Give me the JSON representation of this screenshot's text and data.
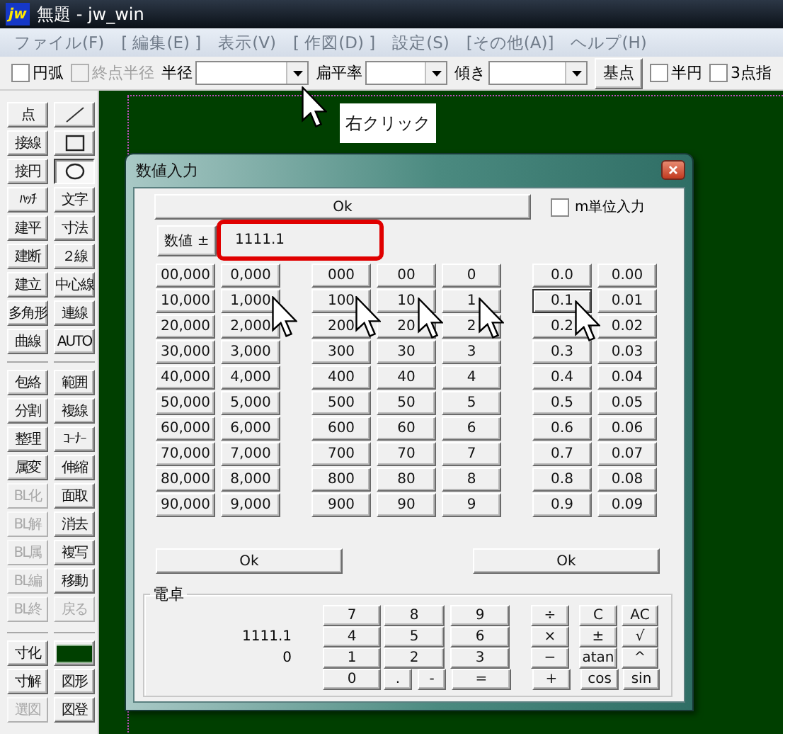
{
  "window": {
    "logo": "jw",
    "title": "無題 - jw_win"
  },
  "menu": [
    "ファイル(F)",
    "[ 編集(E) ]",
    "表示(V)",
    "[ 作図(D) ]",
    "設定(S)",
    "[その他(A)]",
    "ヘルプ(H)"
  ],
  "toolbar": [
    {
      "kind": "checkbox",
      "label": "円弧",
      "checked": false,
      "disabled": false
    },
    {
      "kind": "checkbox",
      "label": "終点半径",
      "checked": false,
      "disabled": true
    },
    {
      "kind": "combo",
      "label": "半径"
    },
    {
      "kind": "combo",
      "label": "扁平率"
    },
    {
      "kind": "combo",
      "label": "傾き"
    },
    {
      "kind": "button",
      "label": "基点"
    },
    {
      "kind": "checkbox",
      "label": "半円",
      "checked": false,
      "disabled": false
    },
    {
      "kind": "checkbox",
      "label": "3点指",
      "checked": false,
      "disabled": false
    }
  ],
  "callout": "右クリック",
  "tool_panel": {
    "columns": [
      {
        "groups": [
          [
            {
              "kind": "text",
              "label": "点",
              "selected": false,
              "disabled": false
            },
            {
              "kind": "text",
              "label": "接線",
              "selected": false,
              "disabled": false
            },
            {
              "kind": "text",
              "label": "接円",
              "selected": false,
              "disabled": false
            },
            {
              "kind": "text",
              "label": "ﾊｯﾁ",
              "selected": false,
              "disabled": false
            },
            {
              "kind": "text",
              "label": "建平",
              "selected": false,
              "disabled": false
            },
            {
              "kind": "text",
              "label": "建断",
              "selected": false,
              "disabled": false
            },
            {
              "kind": "text",
              "label": "建立",
              "selected": false,
              "disabled": false
            },
            {
              "kind": "text",
              "label": "多角形",
              "selected": false,
              "disabled": false
            },
            {
              "kind": "text",
              "label": "曲線",
              "selected": false,
              "disabled": false
            }
          ],
          [
            {
              "kind": "text",
              "label": "包絡",
              "selected": false,
              "disabled": false
            },
            {
              "kind": "text",
              "label": "分割",
              "selected": false,
              "disabled": false
            },
            {
              "kind": "text",
              "label": "整理",
              "selected": false,
              "disabled": false
            },
            {
              "kind": "text",
              "label": "属変",
              "selected": false,
              "disabled": false
            },
            {
              "kind": "text",
              "label": "BL化",
              "selected": false,
              "disabled": true
            },
            {
              "kind": "text",
              "label": "BL解",
              "selected": false,
              "disabled": true
            },
            {
              "kind": "text",
              "label": "BL属",
              "selected": false,
              "disabled": true
            },
            {
              "kind": "text",
              "label": "BL編",
              "selected": false,
              "disabled": true
            },
            {
              "kind": "text",
              "label": "BL終",
              "selected": false,
              "disabled": true
            }
          ],
          [
            {
              "kind": "text",
              "label": "寸化",
              "selected": false,
              "disabled": false
            },
            {
              "kind": "text",
              "label": "寸解",
              "selected": false,
              "disabled": false
            },
            {
              "kind": "text",
              "label": "選図",
              "selected": false,
              "disabled": true
            }
          ]
        ]
      },
      {
        "groups": [
          [
            {
              "kind": "line",
              "selected": false,
              "disabled": false
            },
            {
              "kind": "rect",
              "selected": false,
              "disabled": false
            },
            {
              "kind": "circle",
              "selected": true,
              "disabled": false
            },
            {
              "kind": "text",
              "label": "文字",
              "selected": false,
              "disabled": false
            },
            {
              "kind": "text",
              "label": "寸法",
              "selected": false,
              "disabled": false
            },
            {
              "kind": "text",
              "label": "２線",
              "selected": false,
              "disabled": false
            },
            {
              "kind": "text",
              "label": "中心線",
              "selected": false,
              "disabled": false
            },
            {
              "kind": "text",
              "label": "連線",
              "selected": false,
              "disabled": false
            },
            {
              "kind": "text",
              "label": "AUTO",
              "selected": false,
              "disabled": false
            }
          ],
          [
            {
              "kind": "text",
              "label": "範囲",
              "selected": false,
              "disabled": false
            },
            {
              "kind": "text",
              "label": "複線",
              "selected": false,
              "disabled": false
            },
            {
              "kind": "text",
              "label": "ｺｰﾅｰ",
              "selected": false,
              "disabled": false
            },
            {
              "kind": "text",
              "label": "伸縮",
              "selected": false,
              "disabled": false
            },
            {
              "kind": "text",
              "label": "面取",
              "selected": false,
              "disabled": false
            },
            {
              "kind": "text",
              "label": "消去",
              "selected": false,
              "disabled": false
            },
            {
              "kind": "text",
              "label": "複写",
              "selected": false,
              "disabled": false
            },
            {
              "kind": "text",
              "label": "移動",
              "selected": false,
              "disabled": false
            },
            {
              "kind": "text",
              "label": "戻る",
              "selected": false,
              "disabled": true
            }
          ],
          [
            {
              "kind": "swatch",
              "color": "#004000",
              "selected": false,
              "disabled": false
            },
            {
              "kind": "text",
              "label": "図形",
              "selected": false,
              "disabled": false
            },
            {
              "kind": "text",
              "label": "図登",
              "selected": false,
              "disabled": false
            }
          ]
        ]
      }
    ]
  },
  "dialog": {
    "title": "数値入力",
    "ok_top": "Ok",
    "metric_input": {
      "label": "m単位入力",
      "checked": false
    },
    "value_label": "数値 ±",
    "value": "1111.1",
    "keypad": [
      [
        {
          "label": "00,000",
          "focused": false
        },
        {
          "label": "0,000",
          "focused": false
        },
        {
          "label": "000",
          "focused": false
        },
        {
          "label": "00",
          "focused": false
        },
        {
          "label": "0",
          "focused": false
        },
        {
          "label": "0.0",
          "focused": false
        },
        {
          "label": "0.00",
          "focused": false
        }
      ],
      [
        {
          "label": "10,000",
          "focused": false
        },
        {
          "label": "1,000",
          "focused": false
        },
        {
          "label": "100",
          "focused": false
        },
        {
          "label": "10",
          "focused": false
        },
        {
          "label": "1",
          "focused": false
        },
        {
          "label": "0.1",
          "focused": true
        },
        {
          "label": "0.01",
          "focused": false
        }
      ],
      [
        {
          "label": "20,000",
          "focused": false
        },
        {
          "label": "2,000",
          "focused": false
        },
        {
          "label": "200",
          "focused": false
        },
        {
          "label": "20",
          "focused": false
        },
        {
          "label": "2",
          "focused": false
        },
        {
          "label": "0.2",
          "focused": false
        },
        {
          "label": "0.02",
          "focused": false
        }
      ],
      [
        {
          "label": "30,000",
          "focused": false
        },
        {
          "label": "3,000",
          "focused": false
        },
        {
          "label": "300",
          "focused": false
        },
        {
          "label": "30",
          "focused": false
        },
        {
          "label": "3",
          "focused": false
        },
        {
          "label": "0.3",
          "focused": false
        },
        {
          "label": "0.03",
          "focused": false
        }
      ],
      [
        {
          "label": "40,000",
          "focused": false
        },
        {
          "label": "4,000",
          "focused": false
        },
        {
          "label": "400",
          "focused": false
        },
        {
          "label": "40",
          "focused": false
        },
        {
          "label": "4",
          "focused": false
        },
        {
          "label": "0.4",
          "focused": false
        },
        {
          "label": "0.04",
          "focused": false
        }
      ],
      [
        {
          "label": "50,000",
          "focused": false
        },
        {
          "label": "5,000",
          "focused": false
        },
        {
          "label": "500",
          "focused": false
        },
        {
          "label": "50",
          "focused": false
        },
        {
          "label": "5",
          "focused": false
        },
        {
          "label": "0.5",
          "focused": false
        },
        {
          "label": "0.05",
          "focused": false
        }
      ],
      [
        {
          "label": "60,000",
          "focused": false
        },
        {
          "label": "6,000",
          "focused": false
        },
        {
          "label": "600",
          "focused": false
        },
        {
          "label": "60",
          "focused": false
        },
        {
          "label": "6",
          "focused": false
        },
        {
          "label": "0.6",
          "focused": false
        },
        {
          "label": "0.06",
          "focused": false
        }
      ],
      [
        {
          "label": "70,000",
          "focused": false
        },
        {
          "label": "7,000",
          "focused": false
        },
        {
          "label": "700",
          "focused": false
        },
        {
          "label": "70",
          "focused": false
        },
        {
          "label": "7",
          "focused": false
        },
        {
          "label": "0.7",
          "focused": false
        },
        {
          "label": "0.07",
          "focused": false
        }
      ],
      [
        {
          "label": "80,000",
          "focused": false
        },
        {
          "label": "8,000",
          "focused": false
        },
        {
          "label": "800",
          "focused": false
        },
        {
          "label": "80",
          "focused": false
        },
        {
          "label": "8",
          "focused": false
        },
        {
          "label": "0.8",
          "focused": false
        },
        {
          "label": "0.08",
          "focused": false
        }
      ],
      [
        {
          "label": "90,000",
          "focused": false
        },
        {
          "label": "9,000",
          "focused": false
        },
        {
          "label": "900",
          "focused": false
        },
        {
          "label": "90",
          "focused": false
        },
        {
          "label": "9",
          "focused": false
        },
        {
          "label": "0.9",
          "focused": false
        },
        {
          "label": "0.09",
          "focused": false
        }
      ]
    ],
    "ok_buttons": [
      "Ok",
      "Ok"
    ],
    "calculator": {
      "title": "電卓",
      "rows": [
        {
          "keys": [
            {
              "label": "7",
              "kind": "full"
            },
            {
              "label": "8",
              "kind": "full"
            },
            {
              "label": "9",
              "kind": "full"
            }
          ],
          "functions": [
            "÷",
            "C",
            "AC"
          ]
        },
        {
          "display": "1111.1",
          "keys": [
            {
              "label": "4",
              "kind": "full"
            },
            {
              "label": "5",
              "kind": "full"
            },
            {
              "label": "6",
              "kind": "full"
            }
          ],
          "functions": [
            "×",
            "±",
            "√"
          ]
        },
        {
          "display": "0",
          "keys": [
            {
              "label": "1",
              "kind": "full"
            },
            {
              "label": "2",
              "kind": "full"
            },
            {
              "label": "3",
              "kind": "full"
            }
          ],
          "functions": [
            "−",
            "atan",
            "^"
          ]
        },
        {
          "keys": [
            {
              "label": "0",
              "kind": "full"
            },
            {
              "label": ".",
              "kind": "half"
            },
            {
              "label": "-",
              "kind": "half"
            },
            {
              "label": "=",
              "kind": "full"
            }
          ],
          "functions": [
            "+",
            "cos",
            "sin"
          ]
        }
      ]
    }
  }
}
